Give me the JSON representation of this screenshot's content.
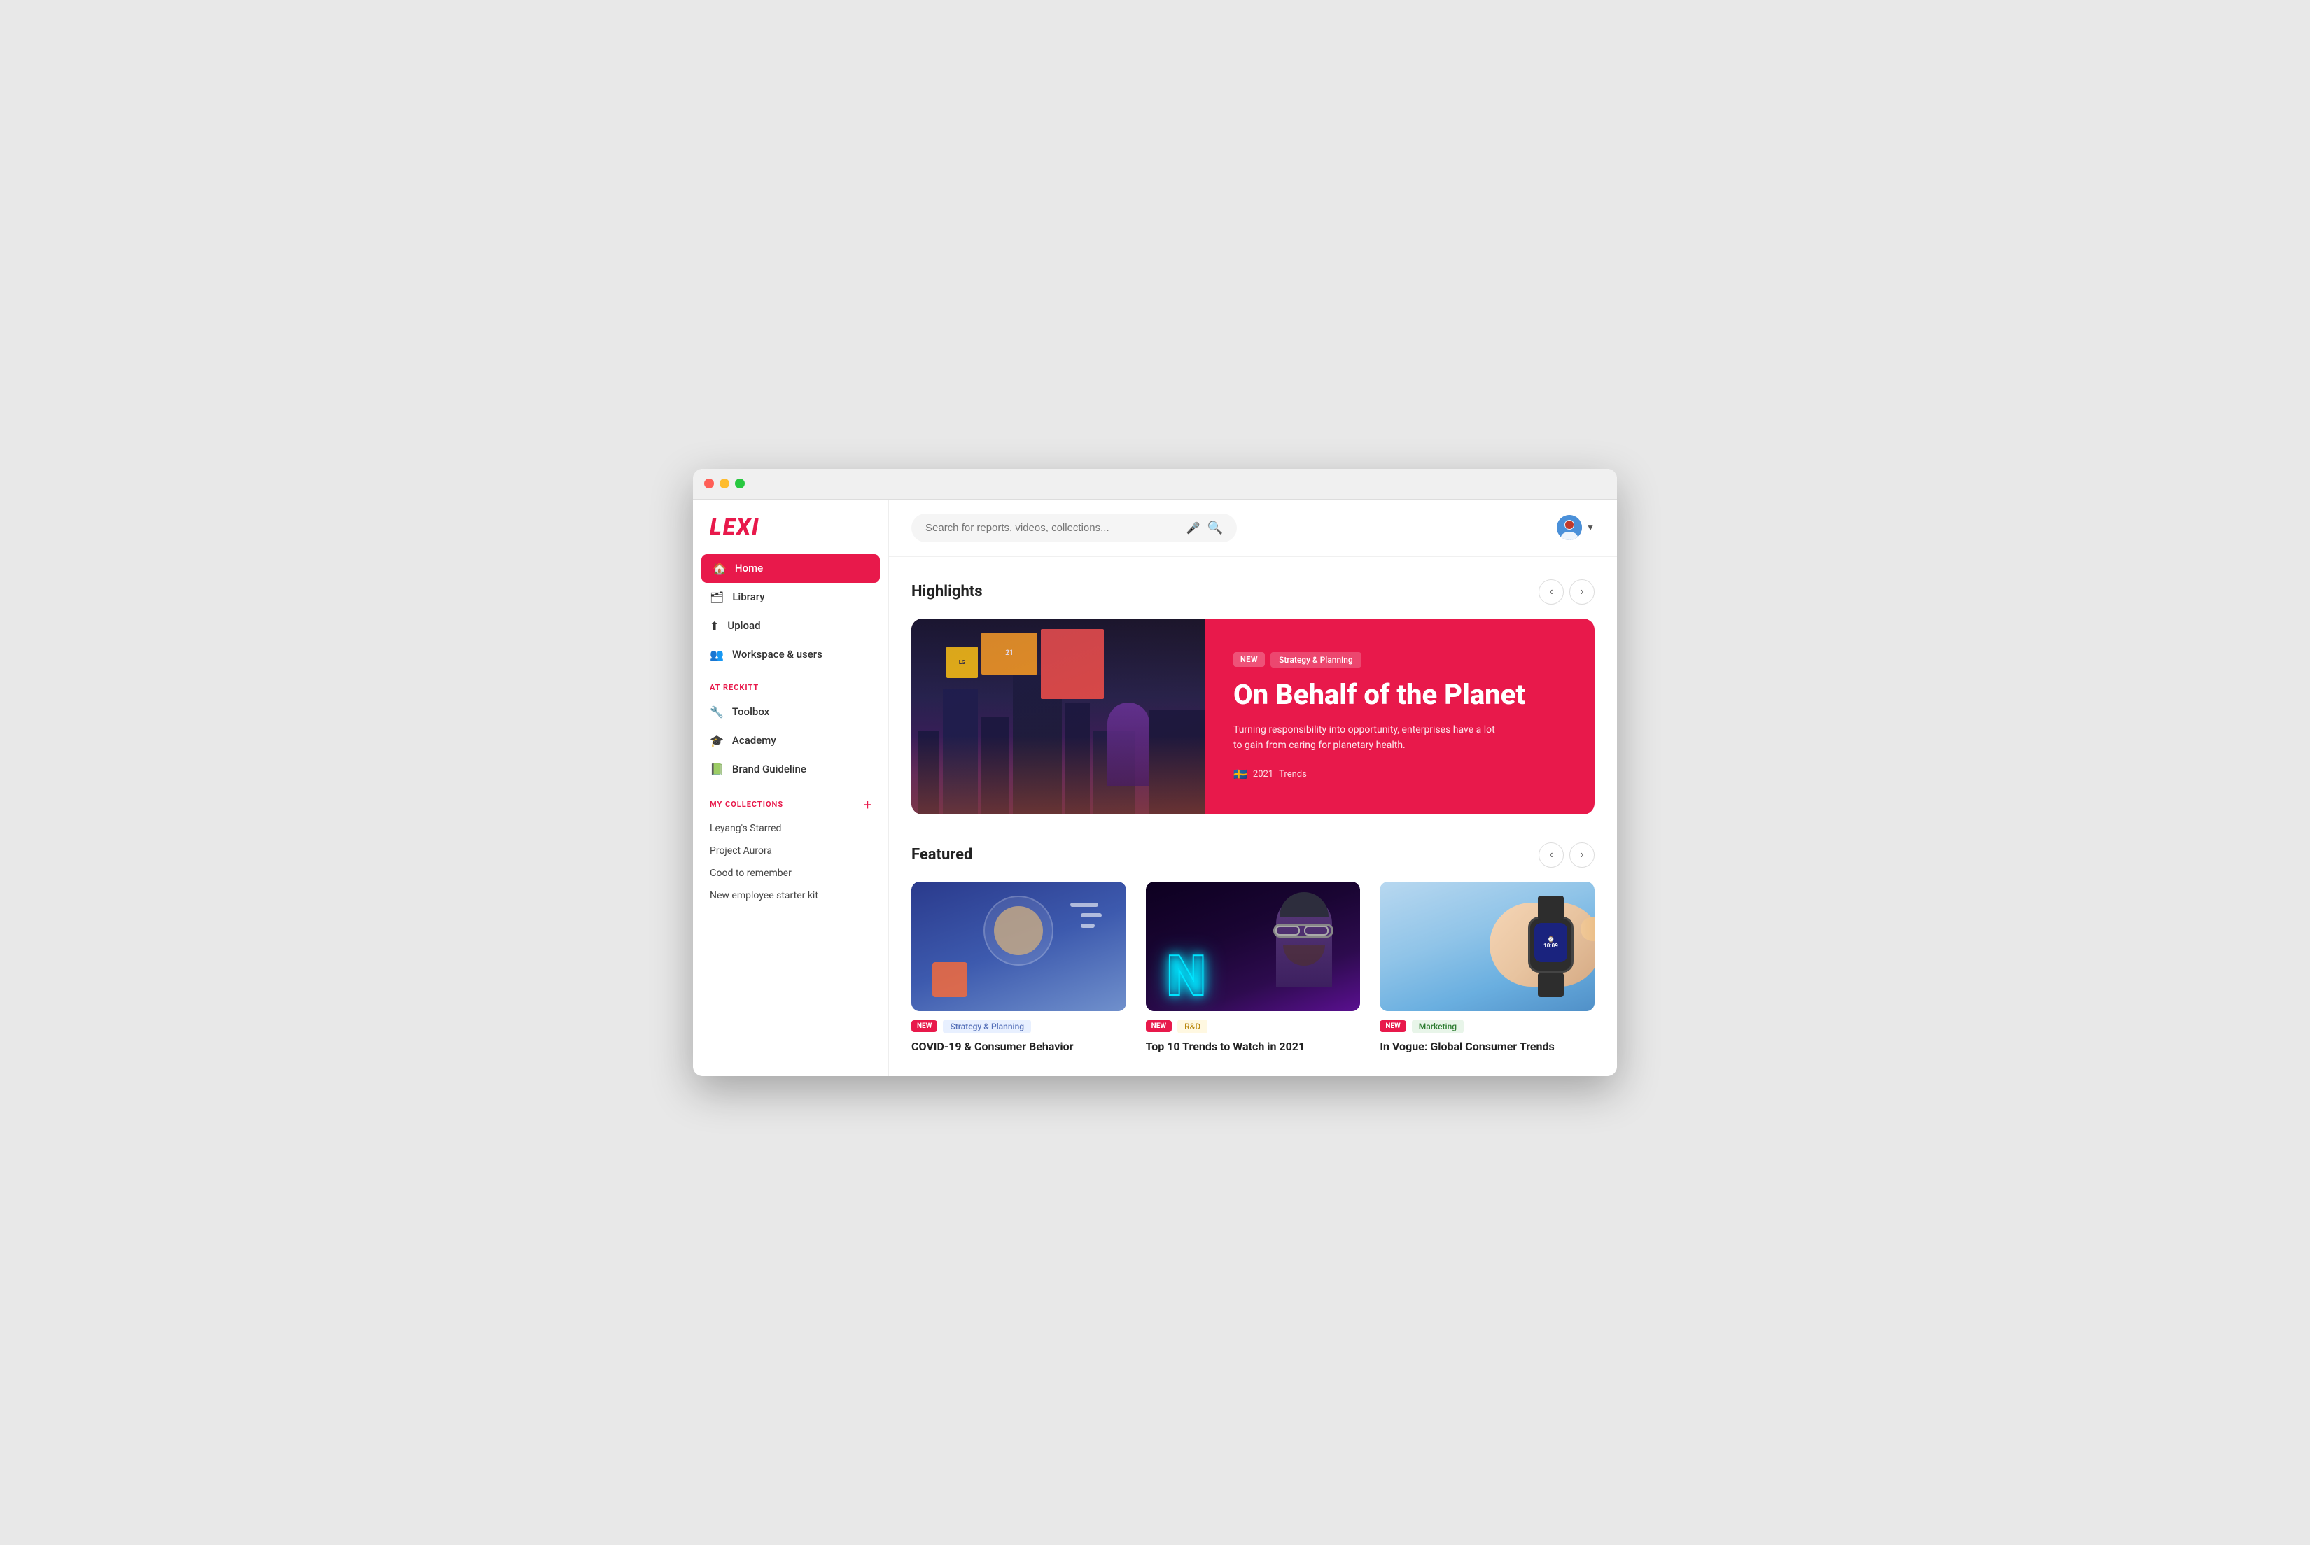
{
  "window": {
    "title": "LEXI"
  },
  "logo": {
    "text": "LEXI"
  },
  "search": {
    "placeholder": "Search for reports, videos, collections..."
  },
  "nav": {
    "items": [
      {
        "id": "home",
        "label": "Home",
        "icon": "🏠",
        "active": true
      },
      {
        "id": "library",
        "label": "Library",
        "icon": "🗑",
        "active": false
      },
      {
        "id": "upload",
        "label": "Upload",
        "icon": "⬆",
        "active": false
      },
      {
        "id": "workspace",
        "label": "Workspace & users",
        "icon": "👥",
        "active": false
      }
    ],
    "atReckittLabel": "AT RECKITT",
    "reckittItems": [
      {
        "id": "toolbox",
        "label": "Toolbox",
        "icon": "🔧"
      },
      {
        "id": "academy",
        "label": "Academy",
        "icon": "🎓"
      },
      {
        "id": "brand",
        "label": "Brand Guideline",
        "icon": "📗"
      }
    ]
  },
  "collections": {
    "sectionLabel": "MY COLLECTIONS",
    "addBtn": "+",
    "items": [
      {
        "id": "starred",
        "label": "Leyang's Starred"
      },
      {
        "id": "aurora",
        "label": "Project Aurora"
      },
      {
        "id": "remember",
        "label": "Good to remember"
      },
      {
        "id": "starter",
        "label": "New employee starter kit"
      }
    ]
  },
  "highlights": {
    "sectionTitle": "Highlights",
    "prevBtn": "‹",
    "nextBtn": "›",
    "item": {
      "tagNew": "NEW",
      "tagCategory": "Strategy & Planning",
      "title": "On Behalf of the Planet",
      "description": "Turning responsibility into opportunity, enterprises have a lot to gain from caring for planetary health.",
      "flag": "🇸🇪",
      "year": "2021",
      "type": "Trends"
    }
  },
  "featured": {
    "sectionTitle": "Featured",
    "prevBtn": "‹",
    "nextBtn": "›",
    "cards": [
      {
        "id": "covid",
        "tagNew": "NEW",
        "tagCategory": "Strategy & Planning",
        "tagCategoryType": "blue",
        "title": "COVID-19 & Consumer Behavior"
      },
      {
        "id": "trends",
        "tagNew": "NEW",
        "tagCategory": "R&D",
        "tagCategoryType": "yellow",
        "title": "Top 10 Trends to Watch in 2021"
      },
      {
        "id": "vogue",
        "tagNew": "NEW",
        "tagCategory": "Marketing",
        "tagCategoryType": "green",
        "title": "In Vogue: Global Consumer Trends"
      }
    ]
  },
  "colors": {
    "primary": "#e8194b",
    "sidebar_bg": "#ffffff",
    "active_nav": "#e8194b"
  }
}
